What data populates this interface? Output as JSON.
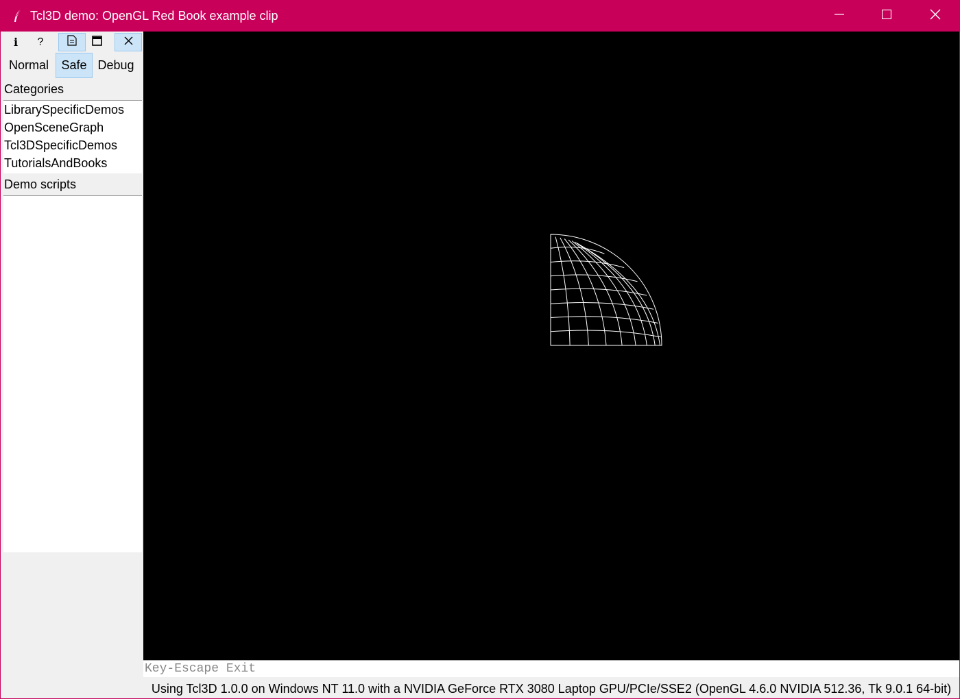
{
  "window": {
    "title": "Tcl3D demo: OpenGL Red Book example clip",
    "accent_color": "#c8005a"
  },
  "titlebar": {
    "app_icon": "feather-icon",
    "minimize_icon": "minimize-icon",
    "maximize_icon": "maximize-icon",
    "close_icon": "close-icon"
  },
  "toolbar": {
    "items": [
      {
        "icon": "info-icon",
        "label": "i"
      },
      {
        "icon": "help-icon",
        "label": "?"
      },
      {
        "icon": "document-icon",
        "active": true
      },
      {
        "icon": "window-icon"
      },
      {
        "icon": "close-icon",
        "active": true
      }
    ]
  },
  "modes": {
    "normal": "Normal",
    "safe": "Safe",
    "debug": "Debug",
    "selected": "Safe"
  },
  "categories": {
    "label": "Categories",
    "items": [
      "LibrarySpecificDemos",
      "OpenSceneGraph",
      "Tcl3DSpecificDemos",
      "TutorialsAndBooks"
    ]
  },
  "demo_scripts": {
    "label": "Demo scripts",
    "items": []
  },
  "status": {
    "key_hint": "Key-Escape Exit",
    "info": "Using Tcl3D 1.0.0 on Windows NT 11.0 with a NVIDIA GeForce RTX 3080 Laptop GPU/PCIe/SSE2 (OpenGL 4.6.0 NVIDIA 512.36, Tk 9.0.1 64-bit)"
  }
}
